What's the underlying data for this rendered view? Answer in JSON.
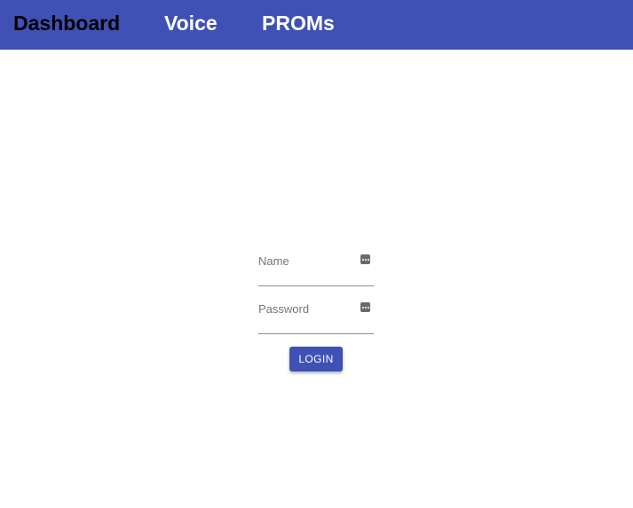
{
  "nav": {
    "items": [
      {
        "label": "Dashboard",
        "active": true
      },
      {
        "label": "Voice",
        "active": false
      },
      {
        "label": "PROMs",
        "active": false
      }
    ]
  },
  "login": {
    "name_label": "Name",
    "name_value": "",
    "password_label": "Password",
    "password_value": "",
    "field_icon": "password-manager-key-icon",
    "button_label": "LOGIN"
  },
  "colors": {
    "primary": "#3f51b5",
    "active_nav": "#000000",
    "nav_text": "#ffffff"
  }
}
